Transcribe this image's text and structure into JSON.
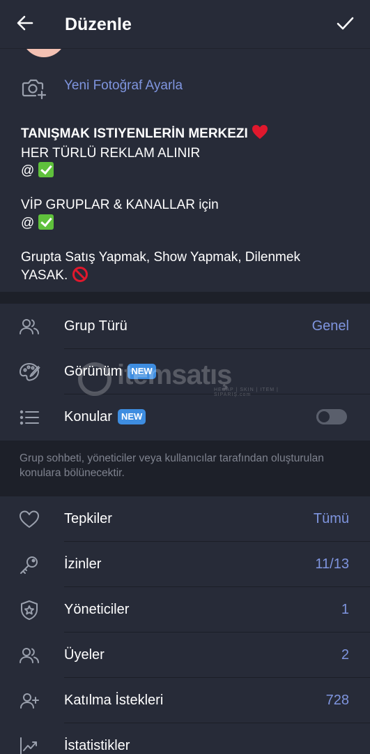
{
  "header": {
    "title": "Düzenle",
    "back_icon": "arrow-left-icon",
    "confirm_icon": "check-icon"
  },
  "photo": {
    "label": "Yeni Fotoğraf Ayarla",
    "icon": "camera-add-icon"
  },
  "description": {
    "line1": "TANIŞMAK ISTIYENLERİN MERKEZI",
    "line2": "HER TÜRLÜ REKLAM ALINIR",
    "line3": "@",
    "line4": "VİP GRUPLAR & KANALLAR için",
    "line5": "@",
    "line6": "Grupta Satış Yapmak, Show Yapmak, Dilenmek",
    "line7": "YASAK."
  },
  "settings_group": {
    "group_type": {
      "label": "Grup Türü",
      "value": "Genel",
      "icon": "users-icon"
    },
    "appearance": {
      "label": "Görünüm",
      "badge": "NEW",
      "icon": "palette-icon"
    },
    "topics": {
      "label": "Konular",
      "badge": "NEW",
      "icon": "list-icon",
      "toggle_on": false
    },
    "hint": "Grup sohbeti, yöneticiler veya kullanıcılar tarafından oluşturulan konulara bölünecektir."
  },
  "admin_group": {
    "reactions": {
      "label": "Tepkiler",
      "value": "Tümü",
      "icon": "heart-icon"
    },
    "permissions": {
      "label": "İzinler",
      "value": "11/13",
      "icon": "key-icon"
    },
    "admins": {
      "label": "Yöneticiler",
      "value": "1",
      "icon": "shield-star-icon"
    },
    "members": {
      "label": "Üyeler",
      "value": "2",
      "icon": "users-icon"
    },
    "join_requests": {
      "label": "Katılma İstekleri",
      "value": "728",
      "icon": "user-add-icon"
    },
    "statistics": {
      "label": "İstatistikler",
      "icon": "chart-up-icon"
    }
  },
  "watermark": {
    "text": "itemsatış",
    "sub": "HESAP | SKIN | ITEM | SIPARIŞ.com"
  },
  "colors": {
    "background": "#1d2029",
    "card": "#272b38",
    "accent": "#7f95df",
    "badge": "#3e8de0",
    "muted_text": "#7e828e",
    "icon": "#9aa0ad"
  }
}
